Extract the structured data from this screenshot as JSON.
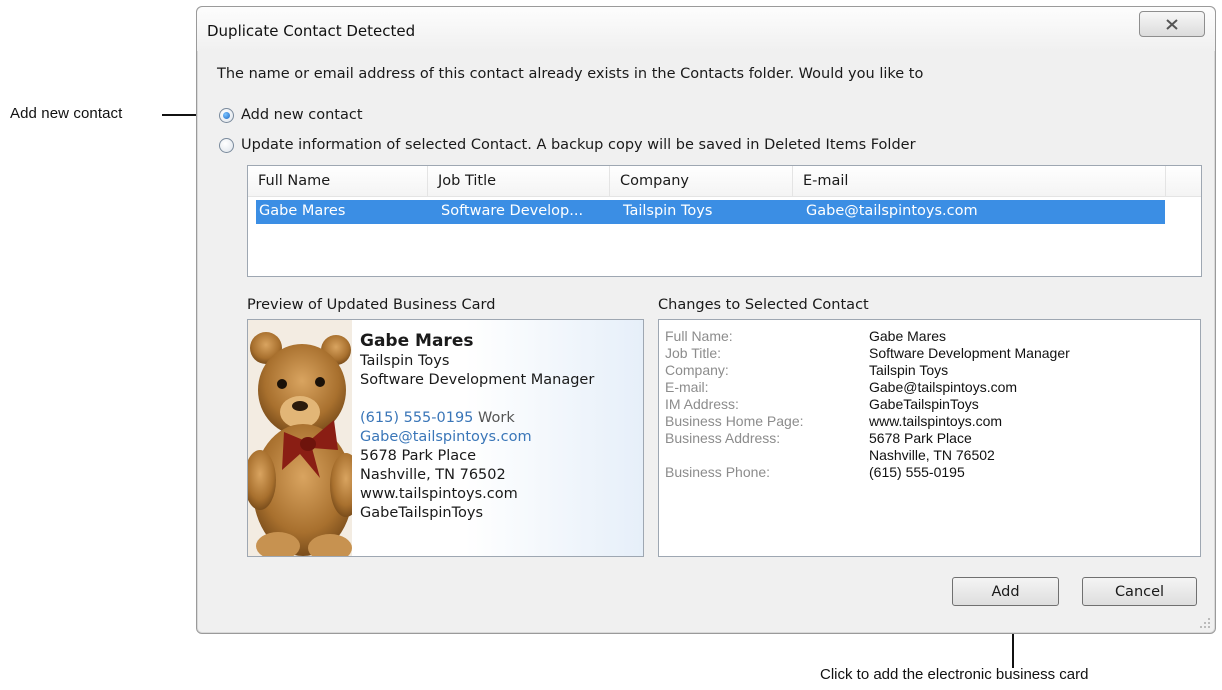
{
  "callouts": {
    "add_new_contact": "Add new contact",
    "add_business_card": "Click to add the electronic business card"
  },
  "dialog": {
    "title": "Duplicate Contact Detected",
    "close_icon": "close-icon",
    "prompt": "The name or email address of this contact already exists in the Contacts folder. Would you like to",
    "options": [
      {
        "label": "Add new contact",
        "checked": true
      },
      {
        "label": "Update information of selected Contact. A backup copy will be saved in Deleted Items Folder",
        "checked": false
      }
    ],
    "list": {
      "columns": [
        "Full Name",
        "Job Title",
        "Company",
        "E-mail"
      ],
      "rows": [
        {
          "full_name": "Gabe Mares",
          "job_title": "Software Develop...",
          "company": "Tailspin Toys",
          "email": "Gabe@tailspintoys.com",
          "selected": true
        }
      ]
    },
    "preview_title": "Preview of Updated Business Card",
    "card": {
      "name": "Gabe Mares",
      "company": "Tailspin Toys",
      "title": "Software Development Manager",
      "phone": "(615) 555-0195",
      "phone_type": "Work",
      "email": "Gabe@tailspintoys.com",
      "street": "5678 Park Place",
      "city": "Nashville, TN 76502",
      "web": "www.tailspintoys.com",
      "im": "GabeTailspinToys"
    },
    "changes_title": "Changes to Selected Contact",
    "changes": [
      {
        "label": "Full Name:",
        "value": "Gabe Mares"
      },
      {
        "label": "Job Title:",
        "value": "Software Development Manager"
      },
      {
        "label": "Company:",
        "value": "Tailspin Toys"
      },
      {
        "label": "E-mail:",
        "value": "Gabe@tailspintoys.com"
      },
      {
        "label": "IM Address:",
        "value": "GabeTailspinToys"
      },
      {
        "label": "Business Home Page:",
        "value": "www.tailspintoys.com"
      },
      {
        "label": "Business Address:",
        "value": "5678 Park Place"
      },
      {
        "label": "",
        "value": "Nashville, TN 76502"
      },
      {
        "label": "Business Phone:",
        "value": "(615) 555-0195"
      }
    ],
    "buttons": {
      "add": "Add",
      "cancel": "Cancel"
    },
    "colors": {
      "selection": "#3b8ee4",
      "link": "#3a76b8"
    }
  }
}
